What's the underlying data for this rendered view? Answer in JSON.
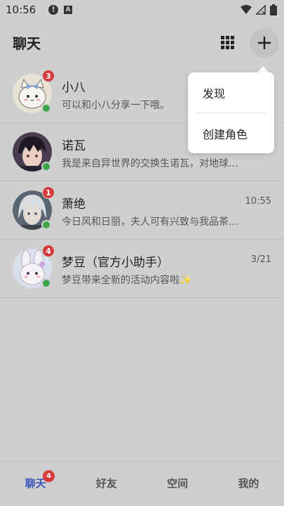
{
  "status_bar": {
    "time": "10:56",
    "icons": [
      "alert-icon",
      "a-icon",
      "wifi-icon",
      "no-signal-icon",
      "battery-icon"
    ]
  },
  "header": {
    "title": "聊天",
    "icons": [
      "grid-icon",
      "plus-icon"
    ]
  },
  "popup": {
    "items": [
      {
        "label": "发现"
      },
      {
        "label": "创建角色"
      }
    ]
  },
  "chats": [
    {
      "name": "小八",
      "time": "",
      "preview": "可以和小八分享一下哦。",
      "unread": "3",
      "online": true,
      "avatar": "cat-avatar"
    },
    {
      "name": "诺瓦",
      "time": "",
      "preview": "我是来自异世界的交换生诺瓦，对地球…",
      "unread": "",
      "online": true,
      "avatar": "dark-hair-boy-avatar"
    },
    {
      "name": "萧绝",
      "time": "10:55",
      "preview": "今日风和日丽，夫人可有兴致与我品茶…",
      "unread": "1",
      "online": true,
      "avatar": "white-hair-man-avatar"
    },
    {
      "name": "梦豆（官方小助手）",
      "time": "3/21",
      "preview": "梦豆带来全新的活动内容啦✨",
      "unread": "4",
      "online": true,
      "avatar": "bunny-avatar"
    }
  ],
  "tabs": [
    {
      "label": "聊天",
      "badge": "4",
      "active": true
    },
    {
      "label": "好友",
      "badge": "",
      "active": false
    },
    {
      "label": "空间",
      "badge": "",
      "active": false
    },
    {
      "label": "我的",
      "badge": "",
      "active": false
    }
  ],
  "colors": {
    "background": "#cfcfcf",
    "accent": "#3d56b8",
    "badge": "#d63a3a",
    "online": "#3aa64a"
  }
}
